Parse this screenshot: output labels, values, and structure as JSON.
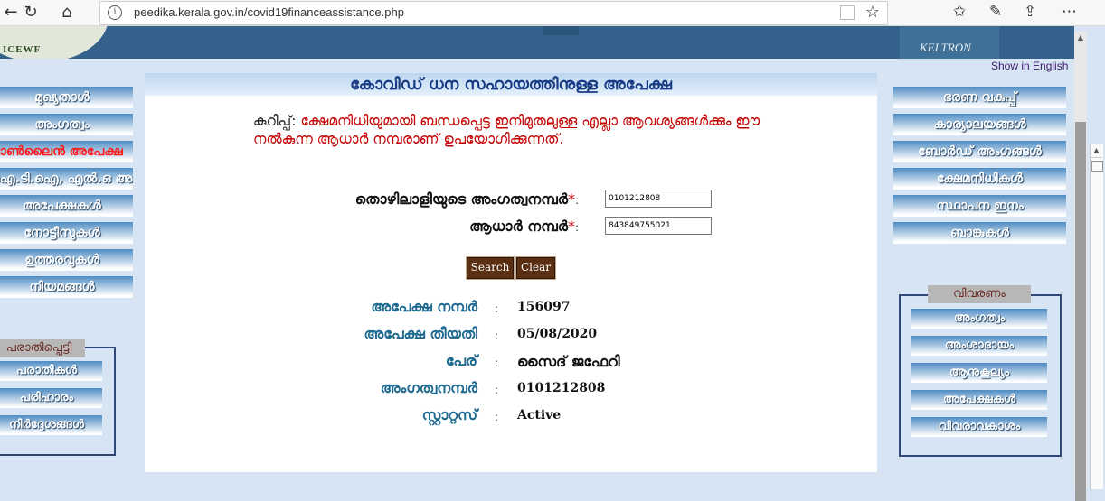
{
  "browser": {
    "url": "peedika.kerala.gov.in/covid19financeassistance.php"
  },
  "header": {
    "logo_left_text": "ICEWF",
    "logo_right_text": "KELTRON",
    "show_in_english": "Show in English"
  },
  "left_menu": [
    {
      "label": "മുഖ്യതാൾ"
    },
    {
      "label": "അംഗത്വം"
    },
    {
      "label": "ഓൺലൈൻ അപേക്ഷ"
    },
    {
      "label": "ഐ.ടി.ഐ, എൽ.ഒ അംഗങ്ങൾ"
    },
    {
      "label": "അപേക്ഷകൾ"
    },
    {
      "label": "നോട്ടീസുകൾ"
    },
    {
      "label": "ഉത്തരവുകൾ"
    },
    {
      "label": "നിയമങ്ങൾ"
    }
  ],
  "left_box": {
    "title": "പരാതിപ്പെട്ടി",
    "items": [
      {
        "label": "പരാതികൾ"
      },
      {
        "label": "പരിഹാരം"
      },
      {
        "label": "നിർദ്ദേശങ്ങൾ"
      }
    ]
  },
  "right_menu": [
    {
      "label": "ഭരണ വകുപ്പ്"
    },
    {
      "label": "കാര്യാലയങ്ങൾ"
    },
    {
      "label": "ബോർഡ് അംഗങ്ങൾ"
    },
    {
      "label": "ക്ഷേമനിധികൾ"
    },
    {
      "label": "സ്ഥാപന ഇനം"
    },
    {
      "label": "ബാങ്കുകൾ"
    }
  ],
  "right_box": {
    "title": "വിവരണം",
    "items": [
      {
        "label": "അംഗത്വം"
      },
      {
        "label": "അംശാദായം"
      },
      {
        "label": "ആനുകൂല്യം"
      },
      {
        "label": "അപേക്ഷകൾ"
      },
      {
        "label": "വിവരാവകാശം"
      }
    ]
  },
  "main": {
    "title": "കോവിഡ് ധന സഹായത്തിനുള്ള അപേക്ഷ",
    "note_label": "കുറിപ്പ്:",
    "note_text": "ക്ഷേമനിധിയുമായി ബന്ധപ്പെട്ട ഇനിമുതലുള്ള എല്ലാ ആവശ്യങ്ങൾക്കും ഈ നൽകുന്ന ആധാർ നമ്പരാണ് ഉപയോഗിക്കുന്നത്.",
    "form": {
      "membership_label": "തൊഴിലാളിയുടെ അംഗത്വനമ്പർ",
      "membership_value": "0101212808",
      "aadhaar_label": "ആധാർ നമ്പർ",
      "aadhaar_value": "843849755021",
      "required_mark": "*",
      "colon": ":",
      "search_label": "Search",
      "clear_label": "Clear"
    },
    "result": [
      {
        "label": "അപേക്ഷ നമ്പർ",
        "value": "156097"
      },
      {
        "label": "അപേക്ഷ തീയതി",
        "value": "05/08/2020"
      },
      {
        "label": "പേര്",
        "value": "സൈദ് ജഫേറി"
      },
      {
        "label": "അംഗത്വനമ്പർ",
        "value": "0101212808"
      },
      {
        "label": "സ്റ്റാറ്റസ്",
        "value": "Active"
      }
    ],
    "result_colon": ":"
  }
}
